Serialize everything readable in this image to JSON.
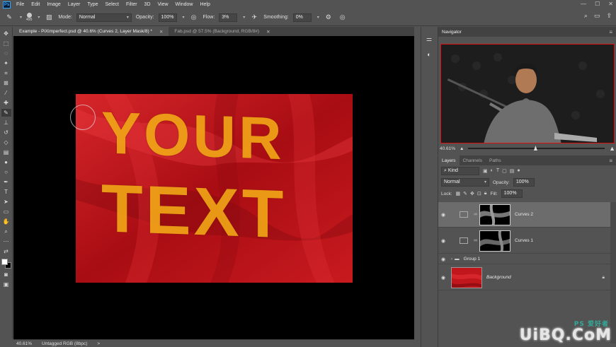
{
  "menubar": {
    "logo": "Ps",
    "items": [
      "File",
      "Edit",
      "Image",
      "Layer",
      "Type",
      "Select",
      "Filter",
      "3D",
      "View",
      "Window",
      "Help"
    ]
  },
  "options": {
    "brush_size": "495",
    "mode_label": "Mode:",
    "mode_value": "Normal",
    "opacity_label": "Opacity:",
    "opacity_value": "100%",
    "flow_label": "Flow:",
    "flow_value": "3%",
    "smoothing_label": "Smoothing:",
    "smoothing_value": "0%"
  },
  "tabs": [
    {
      "label": "Example - PiXimperfect.psd @ 40.6% (Curves 2, Layer Mask/8) *"
    },
    {
      "label": "Fab.psd @ 57.5% (Background, RGB/8#)"
    }
  ],
  "document": {
    "line1": "YOUR",
    "line2": "TEXT",
    "fabric_color": "#c0161c",
    "text_color": "#f0a417"
  },
  "status": {
    "zoom": "40.61%",
    "profile": "Untagged RGB (8bpc)",
    "arrow": ">"
  },
  "navigator": {
    "title": "Navigator",
    "zoom": "40.61%"
  },
  "layers_panel": {
    "tabs": [
      "Layers",
      "Channels",
      "Paths"
    ],
    "kind_label": "Kind",
    "blend_mode": "Normal",
    "opacity_label": "Opacity:",
    "opacity_value": "100%",
    "lock_label": "Lock:",
    "fill_label": "Fill:",
    "fill_value": "100%",
    "layers": [
      {
        "name": "Curves 2",
        "selected": true
      },
      {
        "name": "Curves 1",
        "selected": false
      },
      {
        "name": "Group 1",
        "selected": false
      },
      {
        "name": "Background",
        "selected": false
      }
    ]
  },
  "watermark": {
    "text": "UiBQ.CoM",
    "sub": "PS 爱好者"
  }
}
